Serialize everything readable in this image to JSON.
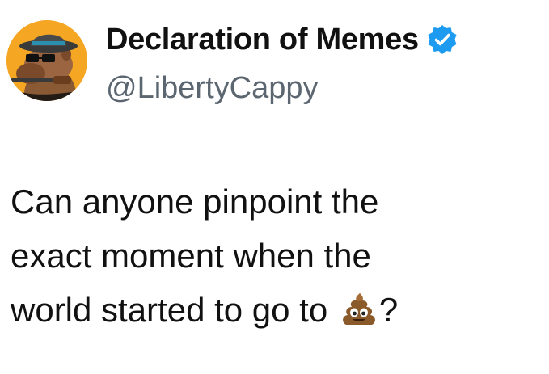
{
  "author": {
    "display_name": "Declaration of Memes",
    "handle": "@LibertyCappy",
    "verified_icon": "verified-badge-icon",
    "avatar_icon": "cowboy-capybara-avatar",
    "badge_color": "#1d9bf0",
    "handle_color": "#5b6670"
  },
  "tweet": {
    "line1": "Can anyone pinpoint the",
    "line2": "exact moment when the",
    "line3": "world started to go to",
    "emoji_icon": "pile-of-poo-icon",
    "ending": "?"
  }
}
